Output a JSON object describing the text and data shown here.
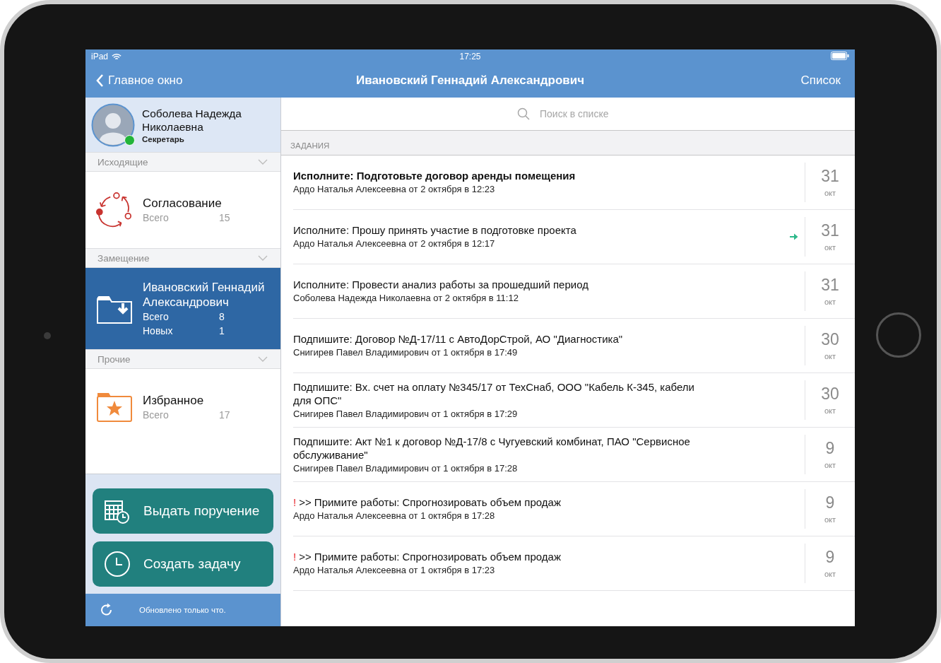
{
  "status_bar": {
    "device": "iPad",
    "time": "17:25"
  },
  "nav_bar": {
    "back": "Главное окно",
    "title": "Ивановский Геннадий Александрович",
    "action": "Список"
  },
  "sidebar": {
    "profile": {
      "name": "Соболева Надежда Николаевна",
      "role": "Секретарь",
      "online": true
    },
    "groups": [
      {
        "title": "Исходящие",
        "items": [
          {
            "kind": "cycle",
            "title": "Согласование",
            "stats": [
              {
                "label": "Всего",
                "value": "15"
              }
            ],
            "selected": false
          }
        ]
      },
      {
        "title": "Замещение",
        "items": [
          {
            "kind": "folder-in",
            "title": "Ивановский Геннадий Александрович",
            "stats": [
              {
                "label": "Всего",
                "value": "8"
              },
              {
                "label": "Новых",
                "value": "1"
              }
            ],
            "selected": true
          }
        ]
      },
      {
        "title": "Прочие",
        "items": [
          {
            "kind": "folder-star",
            "title": "Избранное",
            "stats": [
              {
                "label": "Всего",
                "value": "17"
              }
            ],
            "selected": false
          }
        ]
      }
    ],
    "actions": [
      {
        "kind": "calendar",
        "label": "Выдать поручение"
      },
      {
        "kind": "clock",
        "label": "Создать задачу"
      }
    ],
    "footer": "Обновлено только что."
  },
  "tasks": {
    "search": {
      "placeholder": "Поиск в списке"
    },
    "section": "ЗАДАНИЯ",
    "rows": [
      {
        "title": "Исполните: Подготовьте договор аренды помещения",
        "subtitle": "Ардо Наталья Алексеевна от 2 октября в 12:23",
        "bold": true,
        "forwarded": false,
        "day": "31",
        "month": "окт"
      },
      {
        "title": "Исполните: Прошу принять участие в подготовке проекта",
        "subtitle": "Ардо Наталья Алексеевна от 2 октября в 12:17",
        "bold": false,
        "forwarded": true,
        "day": "31",
        "month": "окт"
      },
      {
        "title": "Исполните: Провести анализ работы за прошедший период",
        "subtitle": "Соболева Надежда Николаевна от 2 октября в 11:12",
        "bold": false,
        "forwarded": false,
        "day": "31",
        "month": "окт"
      },
      {
        "title": "Подпишите: Договор №Д-17/11 с АвтоДорСтрой, АО \"Диагностика\"",
        "subtitle": "Снигирев Павел Владимирович от 1 октября в 17:49",
        "bold": false,
        "forwarded": false,
        "day": "30",
        "month": "окт"
      },
      {
        "title": "Подпишите: Вх. счет на оплату №345/17 от ТехСнаб, ООО \"Кабель К-345, кабели для ОПС\"",
        "subtitle": "Снигирев Павел Владимирович от 1 октября в 17:29",
        "bold": false,
        "forwarded": false,
        "day": "30",
        "month": "окт"
      },
      {
        "title": "Подпишите: Акт №1 к договор №Д-17/8 с Чугуевский комбинат, ПАО \"Сервисное обслуживание\"",
        "subtitle": "Снигирев Павел Владимирович от 1 октября в 17:28",
        "bold": false,
        "forwarded": false,
        "day": "9",
        "month": "окт"
      },
      {
        "flag": "!",
        "title": ">> Примите работы: Спрогнозировать объем продаж",
        "subtitle": "Ардо Наталья Алексеевна от 1 октября в 17:28",
        "bold": false,
        "forwarded": false,
        "day": "9",
        "month": "окт"
      },
      {
        "flag": "!",
        "title": ">> Примите работы: Спрогнозировать объем продаж",
        "subtitle": "Ардо Наталья Алексеевна от 1 октября в 17:23",
        "bold": false,
        "forwarded": false,
        "day": "9",
        "month": "окт"
      }
    ]
  }
}
